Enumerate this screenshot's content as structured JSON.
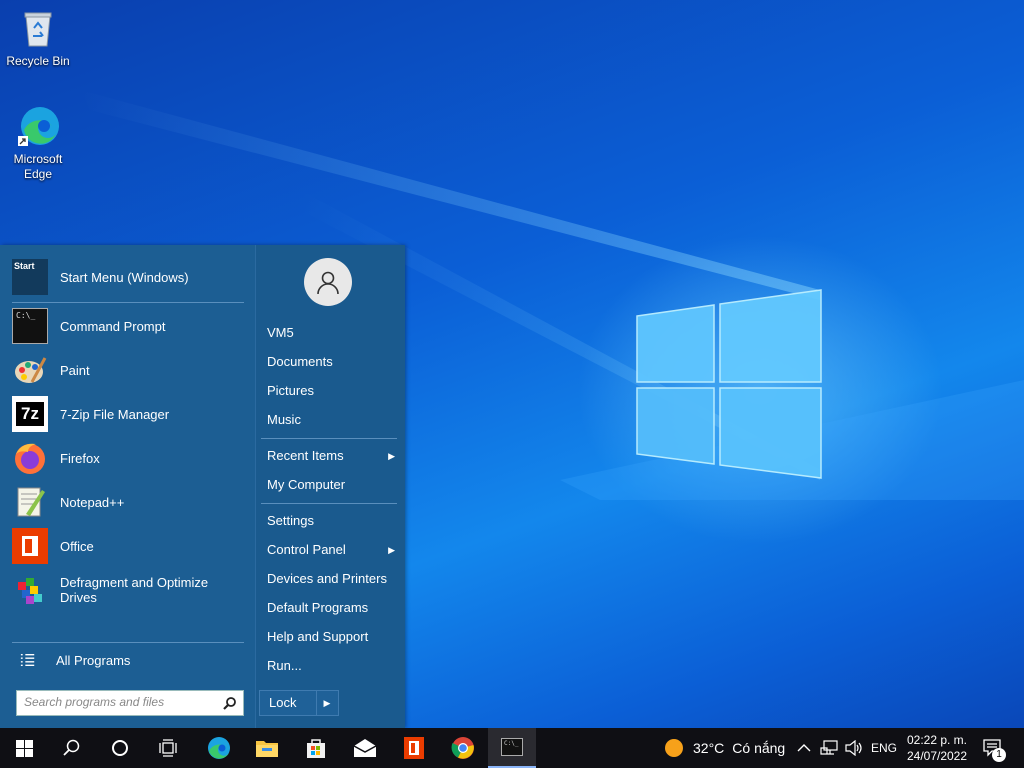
{
  "desktop": {
    "icons": [
      {
        "label": "Recycle Bin",
        "icon": "recycle-bin-icon"
      },
      {
        "label": "Microsoft Edge",
        "icon": "edge-icon"
      }
    ]
  },
  "start_menu": {
    "pinned": {
      "label": "Start Menu (Windows)",
      "icon": "start-menu-icon"
    },
    "programs": [
      {
        "label": "Command Prompt",
        "icon": "cmd-icon"
      },
      {
        "label": "Paint",
        "icon": "paint-icon"
      },
      {
        "label": "7-Zip File Manager",
        "icon": "7zip-icon"
      },
      {
        "label": "Firefox",
        "icon": "firefox-icon"
      },
      {
        "label": "Notepad++",
        "icon": "notepadpp-icon"
      },
      {
        "label": "Office",
        "icon": "office-icon"
      },
      {
        "label": "Defragment and Optimize",
        "label2": "Drives",
        "icon": "defrag-icon"
      }
    ],
    "all_programs": "All Programs",
    "search_placeholder": "Search programs and files",
    "user": {
      "name": "VM5"
    },
    "right_links": [
      {
        "label": "Documents"
      },
      {
        "label": "Pictures"
      },
      {
        "label": "Music"
      },
      {
        "label": "Recent Items",
        "submenu": true
      },
      {
        "label": "My Computer"
      },
      {
        "label": "Settings"
      },
      {
        "label": "Control Panel",
        "submenu": true
      },
      {
        "label": "Devices and Printers"
      },
      {
        "label": "Default Programs"
      },
      {
        "label": "Help and Support"
      },
      {
        "label": "Run..."
      }
    ],
    "lock_label": "Lock"
  },
  "taskbar": {
    "apps": [
      "start-icon",
      "search-icon",
      "cortana-icon",
      "task-view-icon",
      "edge-icon",
      "file-explorer-icon",
      "store-icon",
      "mail-icon",
      "office-icon",
      "chrome-icon",
      "cmd-icon"
    ],
    "weather": {
      "temp": "32°C",
      "condition": "Có nắng"
    },
    "language": "ENG",
    "time": "02:22 p. m.",
    "date": "24/07/2022",
    "notification_count": "1"
  },
  "colors": {
    "menu_bg": "#1c5e93",
    "taskbar_bg": "#0f0f14",
    "desktop_accent": "#0b5fd6"
  }
}
